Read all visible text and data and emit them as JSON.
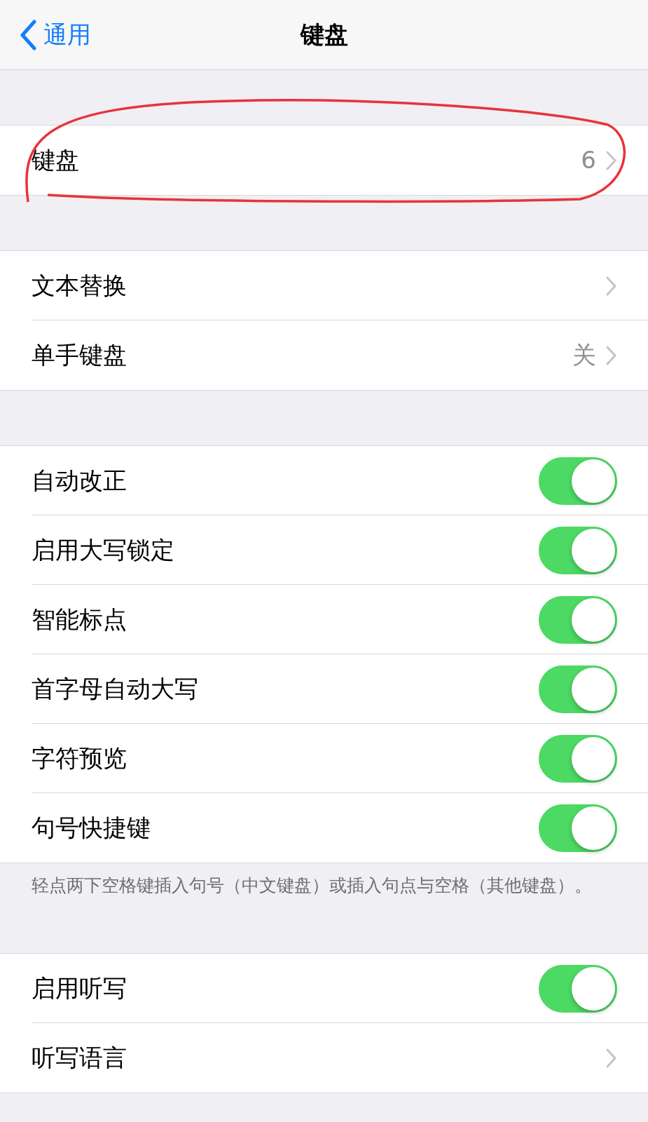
{
  "nav": {
    "back": "通用",
    "title": "键盘"
  },
  "sections": [
    {
      "rows": [
        {
          "kind": "link",
          "label": "键盘",
          "value": "6"
        }
      ]
    },
    {
      "rows": [
        {
          "kind": "link",
          "label": "文本替换"
        },
        {
          "kind": "link",
          "label": "单手键盘",
          "value": "关"
        }
      ]
    },
    {
      "rows": [
        {
          "kind": "toggle",
          "label": "自动改正",
          "on": true
        },
        {
          "kind": "toggle",
          "label": "启用大写锁定",
          "on": true
        },
        {
          "kind": "toggle",
          "label": "智能标点",
          "on": true
        },
        {
          "kind": "toggle",
          "label": "首字母自动大写",
          "on": true
        },
        {
          "kind": "toggle",
          "label": "字符预览",
          "on": true
        },
        {
          "kind": "toggle",
          "label": "句号快捷键",
          "on": true
        }
      ],
      "footer": "轻点两下空格键插入句号（中文键盘）或插入句点与空格（其他键盘）。"
    },
    {
      "rows": [
        {
          "kind": "toggle",
          "label": "启用听写",
          "on": true
        },
        {
          "kind": "link",
          "label": "听写语言"
        }
      ]
    }
  ]
}
